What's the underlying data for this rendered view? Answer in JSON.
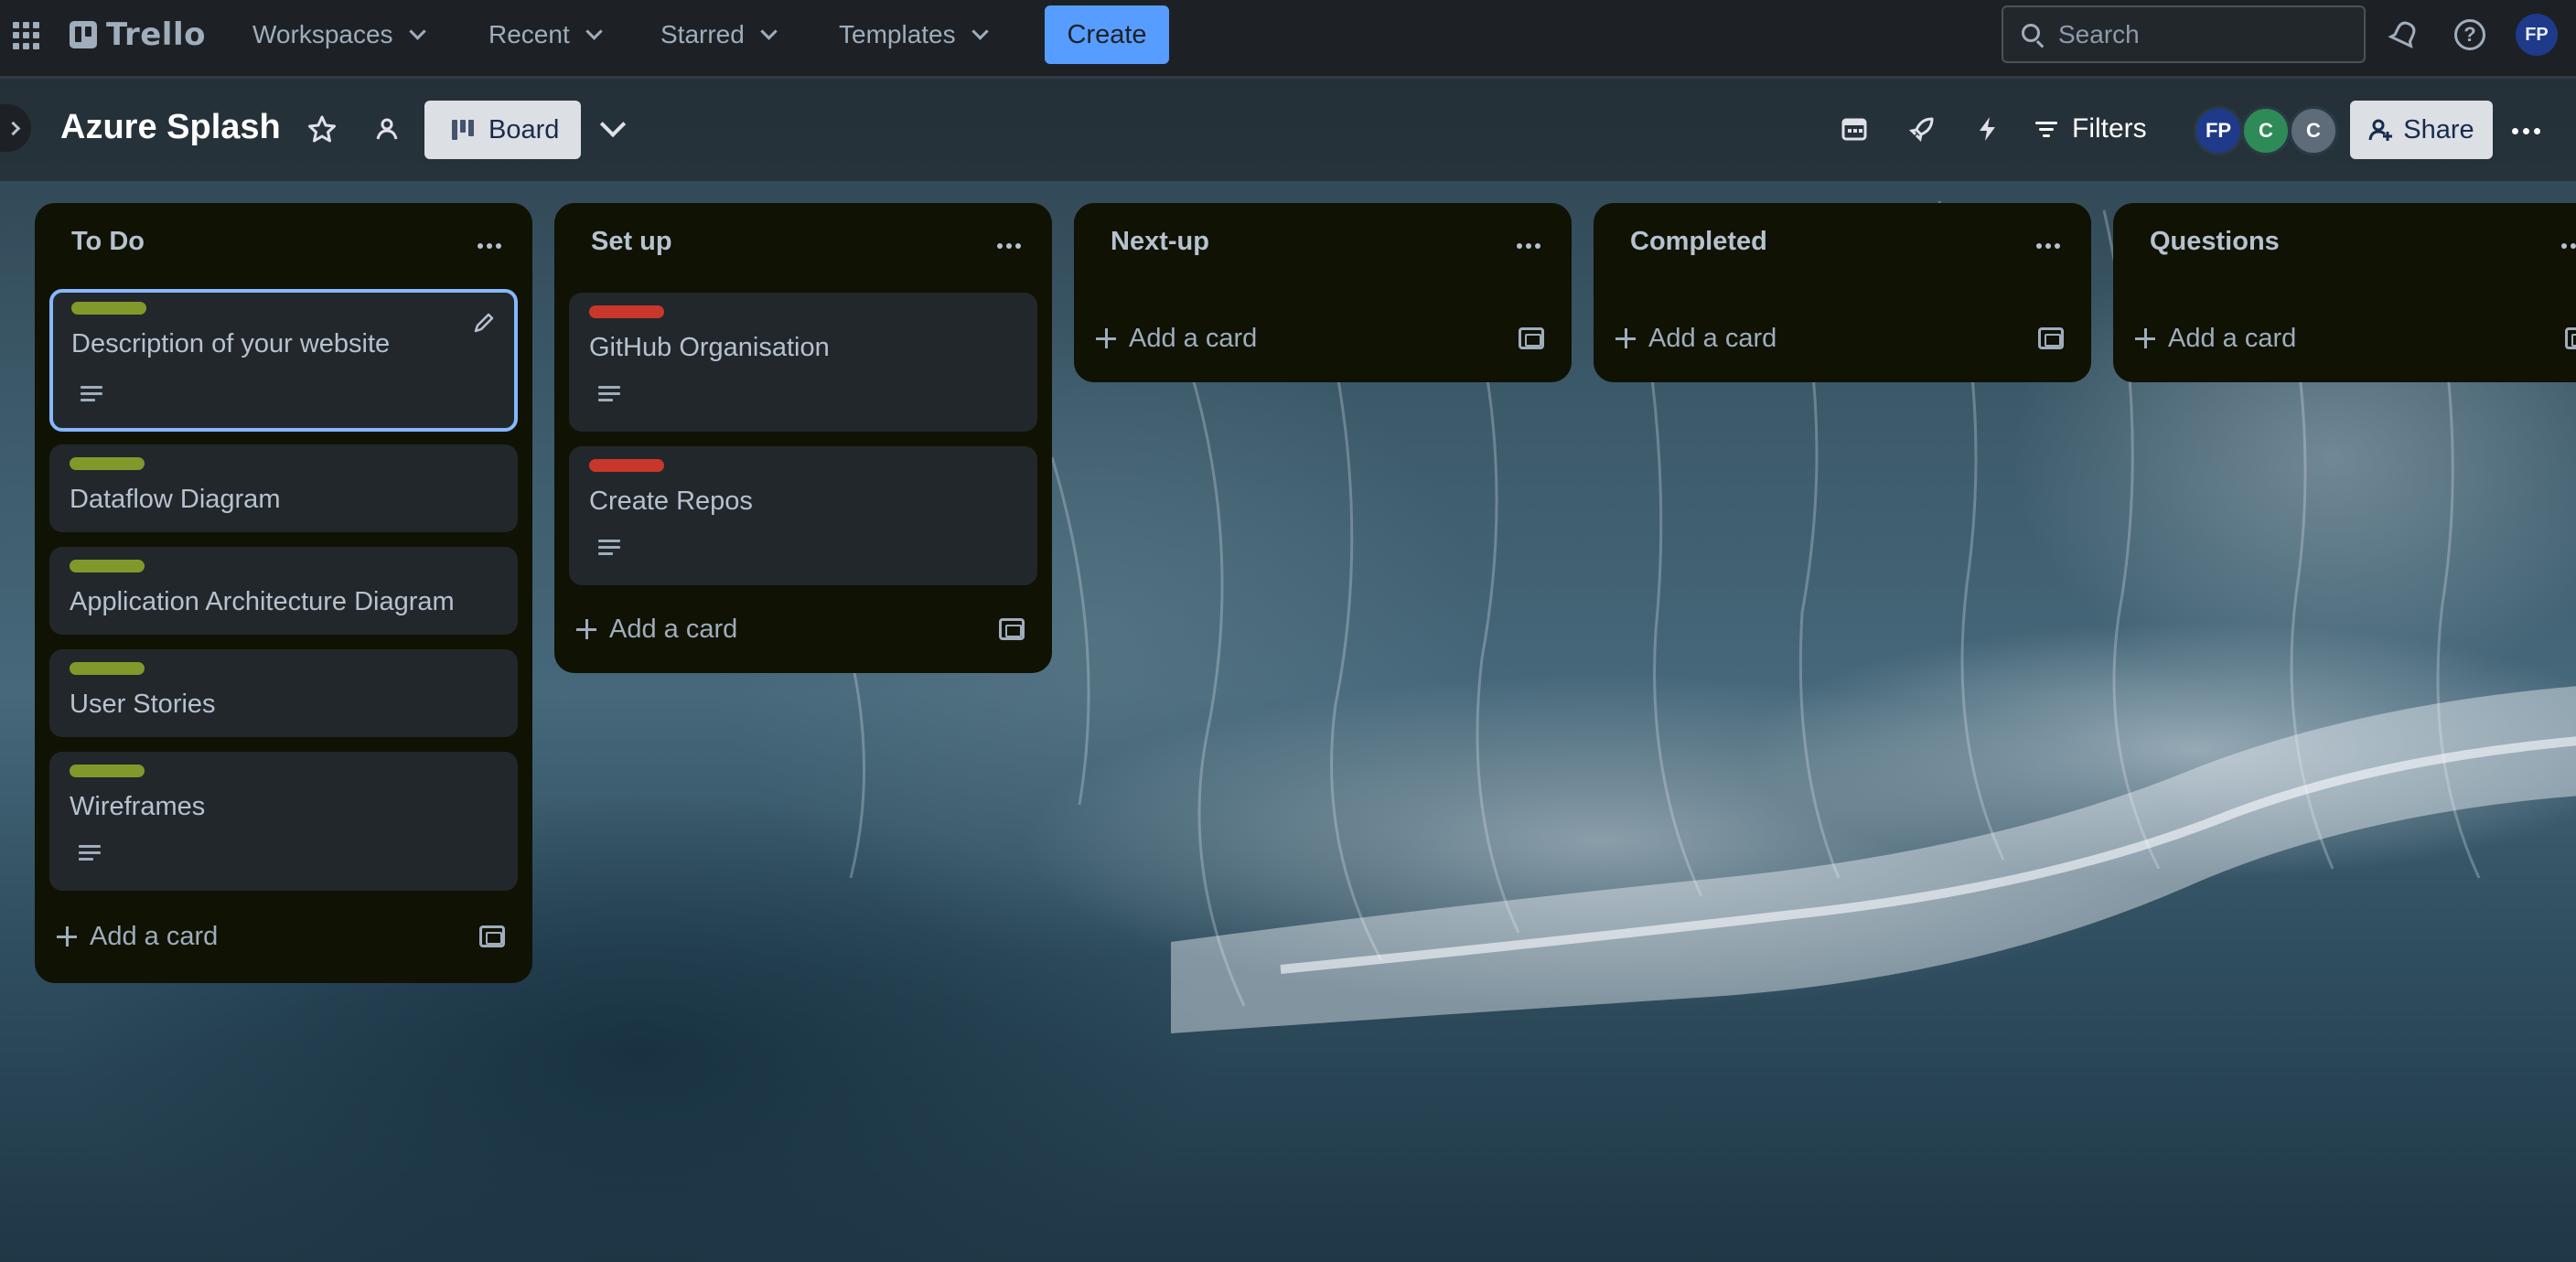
{
  "topbar": {
    "logo_text": "Trello",
    "nav": [
      {
        "label": "Workspaces"
      },
      {
        "label": "Recent"
      },
      {
        "label": "Starred"
      },
      {
        "label": "Templates"
      }
    ],
    "create_label": "Create",
    "search_placeholder": "Search",
    "account_initials": "FP"
  },
  "board": {
    "title": "Azure Splash",
    "view_label": "Board",
    "filters_label": "Filters",
    "share_label": "Share",
    "members": [
      {
        "initials": "FP",
        "color": "#1f3a8a"
      },
      {
        "initials": "C",
        "color": "#2e8b57"
      },
      {
        "initials": "C",
        "color": "#5e6c7a"
      }
    ]
  },
  "colors": {
    "label_green": "#7f9a2a",
    "label_red": "#c9372c",
    "accent_blue": "#579dff",
    "list_bg": "#101204",
    "card_bg": "#22272b"
  },
  "lists": [
    {
      "title": "To Do",
      "cards": [
        {
          "title": "Description of your website",
          "label": "green",
          "has_description": true,
          "selected": true
        },
        {
          "title": "Dataflow Diagram",
          "label": "green",
          "has_description": false
        },
        {
          "title": "Application Architecture Diagram",
          "label": "green",
          "has_description": false
        },
        {
          "title": "User Stories",
          "label": "green",
          "has_description": false
        },
        {
          "title": "Wireframes",
          "label": "green",
          "has_description": true
        }
      ],
      "add_card_label": "Add a card"
    },
    {
      "title": "Set up",
      "cards": [
        {
          "title": "GitHub Organisation",
          "label": "red",
          "has_description": true
        },
        {
          "title": "Create Repos",
          "label": "red",
          "has_description": true
        }
      ],
      "add_card_label": "Add a card"
    },
    {
      "title": "Next-up",
      "cards": [],
      "add_card_label": "Add a card"
    },
    {
      "title": "Completed",
      "cards": [],
      "add_card_label": "Add a card"
    },
    {
      "title": "Questions",
      "cards": [],
      "add_card_label": "Add a card"
    }
  ]
}
